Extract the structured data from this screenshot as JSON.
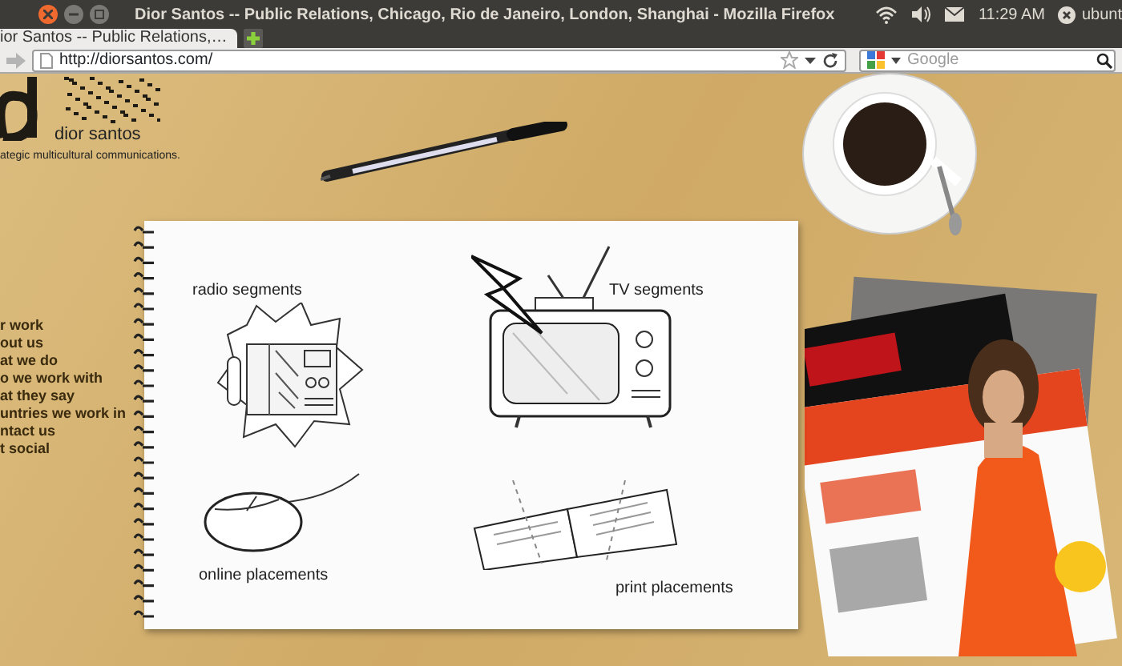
{
  "window": {
    "title": "Dior Santos -- Public Relations, Chicago, Rio de Janeiro, London, Shanghai - Mozilla Firefox"
  },
  "panel": {
    "clock": "11:29 AM",
    "user": "ubunt"
  },
  "tabs": [
    {
      "label": "ior Santos -- Public Relations,…",
      "selected": true
    }
  ],
  "toolbar": {
    "url": "http://diorsantos.com/",
    "search_placeholder": "Google"
  },
  "site": {
    "brand": "dior santos",
    "tagline": "ategic multicultural communications.",
    "menu": [
      "r work",
      "out us",
      "at we do",
      "o we work with",
      "at they say",
      "untries we work in",
      "ntact us",
      "t social"
    ],
    "notebook": [
      {
        "kind": "radio",
        "label": "radio segments"
      },
      {
        "kind": "tv",
        "label": "TV segments"
      },
      {
        "kind": "mouse",
        "label": "online placements"
      },
      {
        "kind": "magazine",
        "label": "print placements"
      }
    ]
  }
}
